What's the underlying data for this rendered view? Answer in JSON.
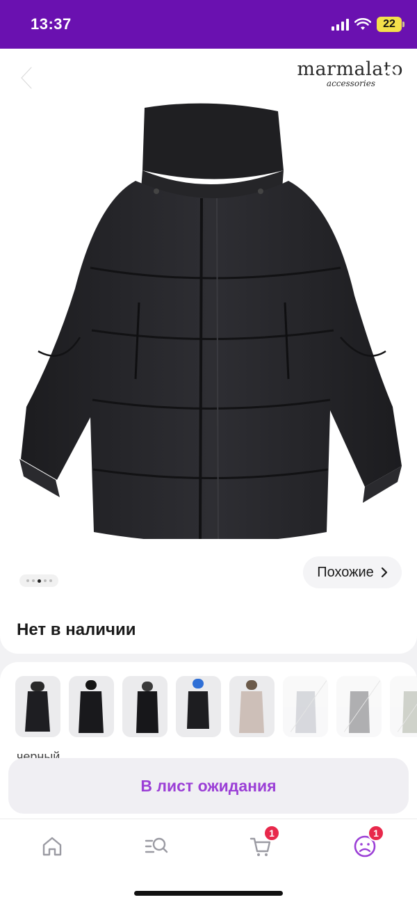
{
  "status_bar": {
    "time": "13:37",
    "battery": "22"
  },
  "header": {
    "brand_name": "marmalato",
    "brand_sub": "accessories"
  },
  "gallery": {
    "similar_label": "Похожие",
    "dots_count": 5,
    "active_dot": 2
  },
  "availability": {
    "text": "Нет в наличии"
  },
  "variants": {
    "thumbnails": [
      {
        "name": "variant-1",
        "available": true
      },
      {
        "name": "variant-2",
        "available": true
      },
      {
        "name": "variant-3",
        "available": true
      },
      {
        "name": "variant-4",
        "available": true
      },
      {
        "name": "variant-5",
        "available": true
      },
      {
        "name": "variant-6",
        "available": false
      },
      {
        "name": "variant-7",
        "available": false
      },
      {
        "name": "variant-8",
        "available": false
      }
    ],
    "color_label": "черный"
  },
  "actions": {
    "waitlist_label": "В лист ожидания"
  },
  "bottom_nav": {
    "items": [
      {
        "icon": "home-icon"
      },
      {
        "icon": "catalog-search-icon"
      },
      {
        "icon": "cart-icon",
        "badge": "1"
      },
      {
        "icon": "profile-icon",
        "badge": "1"
      }
    ],
    "accent": "#9b3fd6"
  },
  "colors": {
    "status_bar": "#6a11b0",
    "accent": "#9b3fd6",
    "badge": "#e8284b"
  }
}
